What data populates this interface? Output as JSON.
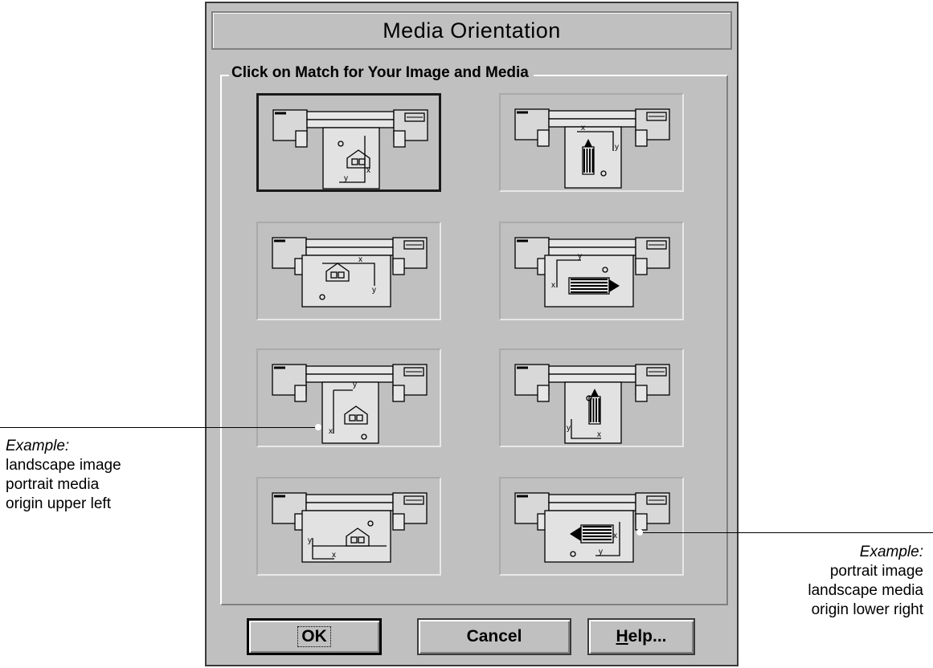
{
  "dialog": {
    "title": "Media Orientation",
    "group_label": "Click on Match for Your Image and Media",
    "options": [
      {
        "id": "opt-1",
        "axis_labels": [
          "x",
          "y"
        ],
        "selected": true
      },
      {
        "id": "opt-2",
        "axis_labels": [
          "x",
          "y"
        ],
        "selected": false
      },
      {
        "id": "opt-3",
        "axis_labels": [
          "x",
          "y"
        ],
        "selected": false
      },
      {
        "id": "opt-4",
        "axis_labels": [
          "y",
          "x"
        ],
        "selected": false
      },
      {
        "id": "opt-5",
        "axis_labels": [
          "y",
          "x"
        ],
        "selected": false
      },
      {
        "id": "opt-6",
        "axis_labels": [
          "y",
          "x"
        ],
        "selected": false
      },
      {
        "id": "opt-7",
        "axis_labels": [
          "y",
          "x"
        ],
        "selected": false
      },
      {
        "id": "opt-8",
        "axis_labels": [
          "x",
          "y"
        ],
        "selected": false
      }
    ],
    "buttons": {
      "ok": "OK",
      "cancel": "Cancel",
      "help_mnemonic": "H",
      "help_rest": "elp..."
    }
  },
  "callouts": {
    "left": {
      "heading": "Example:",
      "lines": [
        "landscape image",
        "portrait media",
        "origin upper left"
      ]
    },
    "right": {
      "heading": "Example:",
      "lines": [
        "portrait image",
        "landscape media",
        "origin lower right"
      ]
    }
  },
  "colors": {
    "dialog_face": "#c0c0c0",
    "ink": "#000000",
    "highlight": "#ffffff",
    "shadow": "#808080"
  },
  "icons": {
    "plotter": "plotter-icon",
    "house": "house-icon",
    "tower": "tower-icon"
  }
}
